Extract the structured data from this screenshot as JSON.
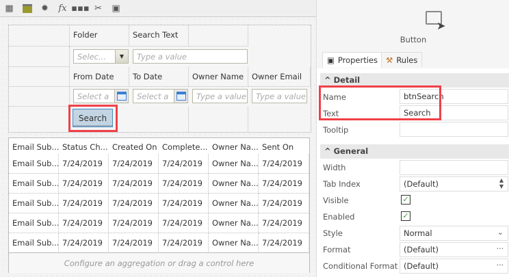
{
  "toolbar": {
    "icons": [
      "table-lightning-icon",
      "image-edit-icon",
      "gear-icon",
      "fx-icon",
      "more-icon",
      "tools-icon",
      "properties-icon"
    ],
    "fx_label": "fx"
  },
  "form": {
    "labels": {
      "folder": "Folder",
      "search_text": "Search Text",
      "from_date": "From Date",
      "to_date": "To Date",
      "owner_name": "Owner Name",
      "owner_email": "Owner Email"
    },
    "placeholders": {
      "folder": "Selec...",
      "search_text": "Type a value",
      "from_date": "Select a",
      "to_date": "Select a",
      "owner_name": "Type a value",
      "owner_email": "Type a value"
    },
    "search_button": "Search"
  },
  "grid": {
    "headers": [
      "Email Sub...",
      "Status Ch...",
      "Created On",
      "Complete...",
      "Owner Na...",
      "Sent On"
    ],
    "rows": [
      [
        "Email Sub...",
        "7/24/2019",
        "7/24/2019",
        "7/24/2019",
        "Owner Na...",
        "7/24/2019"
      ],
      [
        "Email Sub...",
        "7/24/2019",
        "7/24/2019",
        "7/24/2019",
        "Owner Na...",
        "7/24/2019"
      ],
      [
        "Email Sub...",
        "7/24/2019",
        "7/24/2019",
        "7/24/2019",
        "Owner Na...",
        "7/24/2019"
      ],
      [
        "Email Sub...",
        "7/24/2019",
        "7/24/2019",
        "7/24/2019",
        "Owner Na...",
        "7/24/2019"
      ],
      [
        "Email Sub...",
        "7/24/2019",
        "7/24/2019",
        "7/24/2019",
        "Owner Na...",
        "7/24/2019"
      ]
    ],
    "footer": "Configure an aggregation or drag a control here"
  },
  "panel": {
    "control_type": "Button",
    "tabs": [
      "Properties",
      "Rules"
    ],
    "detail": {
      "title": "Detail",
      "name_label": "Name",
      "name_value": "btnSearch",
      "text_label": "Text",
      "text_value": "Search",
      "tooltip_label": "Tooltip",
      "tooltip_value": ""
    },
    "general": {
      "title": "General",
      "width_label": "Width",
      "width_value": "",
      "tab_index_label": "Tab Index",
      "tab_index_value": "(Default)",
      "visible_label": "Visible",
      "visible": true,
      "enabled_label": "Enabled",
      "enabled": true,
      "style_label": "Style",
      "style_value": "Normal",
      "format_label": "Format",
      "format_value": "(Default)",
      "cond_format_label": "Conditional Format",
      "cond_format_value": "(Default)"
    }
  },
  "colors": {
    "highlight": "#f04048",
    "accent": "#4a8ac0"
  }
}
